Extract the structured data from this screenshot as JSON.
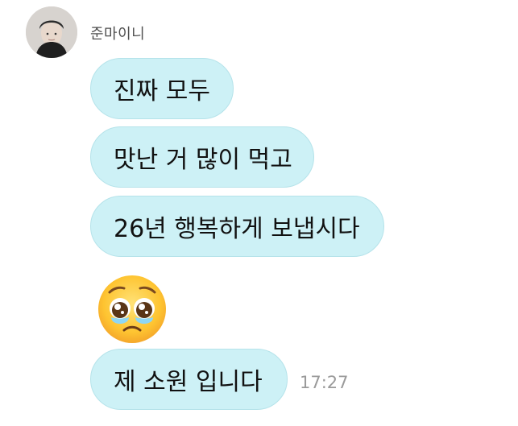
{
  "sender": {
    "name": "준마이니"
  },
  "messages": [
    {
      "text": "진짜 모두"
    },
    {
      "text": "맛난 거 많이 먹고"
    },
    {
      "text": "26년 행복하게 보냅시다"
    },
    {
      "emoji": "pleading-face"
    },
    {
      "text": "제 소원 입니다"
    }
  ],
  "timestamp": "17:27",
  "colors": {
    "bubble_background": "#cdf1f6",
    "bubble_border": "#b5e3ea",
    "timestamp_text": "#9a9a9a",
    "name_text": "#4f4f4f"
  }
}
